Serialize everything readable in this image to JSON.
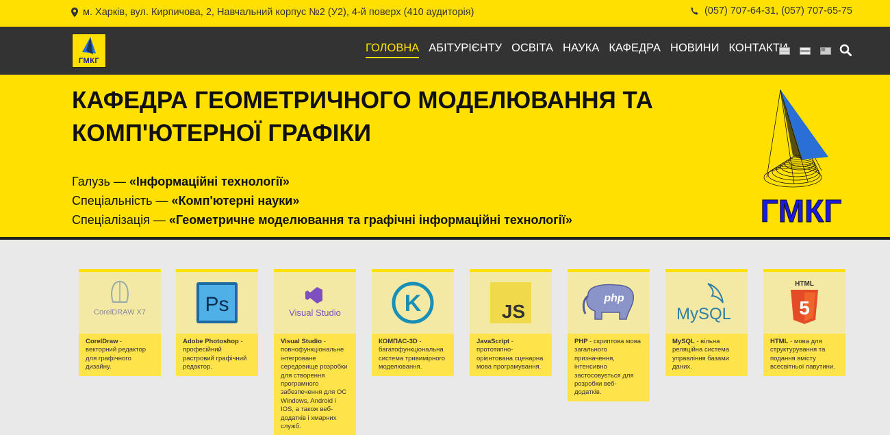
{
  "topbar": {
    "address": "м. Харків, вул. Кирпичова, 2, Навчальний корпус №2 (У2), 4-й поверх (410 аудиторія)",
    "phones": "(057) 707-64-31, (057) 707-65-75",
    "address_icon": "map-marker-icon",
    "phone_icon": "phone-icon"
  },
  "logo": {
    "text": "ГМКГ"
  },
  "nav": {
    "items": [
      "ГОЛОВНА",
      "АБІТУРІЄНТУ",
      "ОСВІТА",
      "НАУКА",
      "КАФЕДРА",
      "НОВИНИ",
      "КОНТАКТИ"
    ],
    "active_index": 0
  },
  "hero": {
    "title": "КАФЕДРА ГЕОМЕТРИЧНОГО МОДЕЛЮВАННЯ ТА КОМП'ЮТЕРНОЇ ГРАФІКИ",
    "lines": [
      {
        "label": "Галузь — ",
        "value": "«Інформаційні технології»"
      },
      {
        "label": "Спеціальність — ",
        "value": "«Комп'ютерні науки»"
      },
      {
        "label": "Спеціалізація — ",
        "value": "«Геометричне моделювання та графічні інформаційні технології»"
      }
    ],
    "logo_text": "ГМКГ"
  },
  "cards": [
    {
      "name": "CorelDraw",
      "desc": " - векторний редактор для графічного дизайну.",
      "logo": "CorelDRAW X7"
    },
    {
      "name": "Adobe Photoshop",
      "desc": " - професійний растровий графічний редактор.",
      "logo": "Ps"
    },
    {
      "name": "Visual Studio",
      "desc": " - повнофункціональне інтегроване середовище розробки для створення програмного забезпечення для ОС Windows, Android і IOS, а також веб-додатків і хмарних служб.",
      "logo": "Visual Studio"
    },
    {
      "name": "КОМПАС-3D",
      "desc": " - багатофункціональна система тривимірного моделювання.",
      "logo": "K"
    },
    {
      "name": "JavaScript",
      "desc": " - прототипно-орієнтована сценарна мова програмування.",
      "logo": "JS"
    },
    {
      "name": "PHP",
      "desc": " - скриптова мова загального призначення, інтенсивно застосовується для розробки веб-додатків.",
      "logo": "php"
    },
    {
      "name": "MySQL",
      "desc": " - вільна реляційна система управління базами даних.",
      "logo": "MySQL"
    },
    {
      "name": "HTML",
      "desc": " - мова для структурування та подання вмісту всесвітньої павутини.",
      "logo": "HTML"
    }
  ],
  "colors": {
    "brand_yellow": "#ffe000",
    "nav_dark": "#333333",
    "logo_blue": "#1a1aa0"
  }
}
